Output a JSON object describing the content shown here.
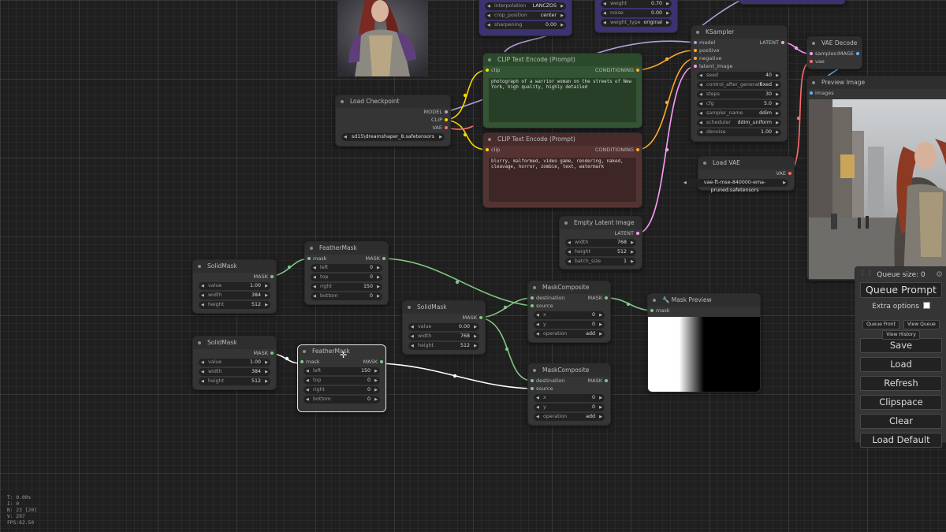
{
  "colors": {
    "model": "#b39ddb",
    "clip": "#ffd500",
    "vae": "#ff6e6e",
    "conditioning": "#ffa931",
    "latent": "#ff9cf9",
    "mask": "#81c784",
    "image": "#64b5f6",
    "selected_link": "#ffffff"
  },
  "nodes": {
    "top1": {
      "widgets": [
        {
          "label": "interpolation",
          "value": "LANCZOS"
        },
        {
          "label": "crop_position",
          "value": "center"
        },
        {
          "label": "sharpening",
          "value": "0.00"
        }
      ]
    },
    "top2": {
      "widgets": [
        {
          "label": "weight",
          "value": "0.70"
        },
        {
          "label": "noise",
          "value": "0.00"
        },
        {
          "label": "weight_type",
          "value": "original"
        }
      ]
    },
    "load_checkpoint": {
      "title": "Load Checkpoint",
      "outputs": [
        "MODEL",
        "CLIP",
        "VAE"
      ],
      "widget": {
        "label": "ckpt_name",
        "value": "sd15\\dreamshaper_8.safetensors"
      }
    },
    "clip_pos": {
      "title": "CLIP Text Encode (Prompt)",
      "input": "clip",
      "output": "CONDITIONING",
      "text": "photograph of a warrior woman on the streets of New York, high quality, highly detailed"
    },
    "clip_neg": {
      "title": "CLIP Text Encode (Prompt)",
      "input": "clip",
      "output": "CONDITIONING",
      "text": "blurry, malformed, video game, rendering, naked, cleavage, horror, zombie, text, watermark"
    },
    "ksampler": {
      "title": "KSampler",
      "inputs": [
        "model",
        "positive",
        "negative",
        "latent_image"
      ],
      "output": "LATENT",
      "widgets": [
        {
          "label": "seed",
          "value": "40"
        },
        {
          "label": "control_after_generate",
          "value": "fixed"
        },
        {
          "label": "steps",
          "value": "30"
        },
        {
          "label": "cfg",
          "value": "5.0"
        },
        {
          "label": "sampler_name",
          "value": "ddim"
        },
        {
          "label": "scheduler",
          "value": "ddim_uniform"
        },
        {
          "label": "denoise",
          "value": "1.00"
        }
      ]
    },
    "vae_decode": {
      "title": "VAE Decode",
      "inputs": [
        "samples",
        "vae"
      ],
      "output": "IMAGE"
    },
    "preview_image": {
      "title": "Preview Image",
      "input": "images"
    },
    "load_vae": {
      "title": "Load VAE",
      "output": "VAE",
      "widget": {
        "label": "vae_name",
        "value": "vae-ft-mse-840000-ema-pruned.safetensors"
      }
    },
    "empty_latent": {
      "title": "Empty Latent Image",
      "output": "LATENT",
      "widgets": [
        {
          "label": "width",
          "value": "768"
        },
        {
          "label": "height",
          "value": "512"
        },
        {
          "label": "batch_size",
          "value": "1"
        }
      ]
    },
    "solidmask1": {
      "title": "SolidMask",
      "output": "MASK",
      "widgets": [
        {
          "label": "value",
          "value": "1.00"
        },
        {
          "label": "width",
          "value": "384"
        },
        {
          "label": "height",
          "value": "512"
        }
      ]
    },
    "feathermask1": {
      "title": "FeatherMask",
      "input": "mask",
      "output": "MASK",
      "widgets": [
        {
          "label": "left",
          "value": "0"
        },
        {
          "label": "top",
          "value": "0"
        },
        {
          "label": "right",
          "value": "150"
        },
        {
          "label": "bottom",
          "value": "0"
        }
      ]
    },
    "solidmask2": {
      "title": "SolidMask",
      "output": "MASK",
      "widgets": [
        {
          "label": "value",
          "value": "1.00"
        },
        {
          "label": "width",
          "value": "384"
        },
        {
          "label": "height",
          "value": "512"
        }
      ]
    },
    "feathermask2": {
      "title": "FeatherMask",
      "input": "mask",
      "output": "MASK",
      "widgets": [
        {
          "label": "left",
          "value": "150"
        },
        {
          "label": "top",
          "value": "0"
        },
        {
          "label": "right",
          "value": "0"
        },
        {
          "label": "bottom",
          "value": "0"
        }
      ]
    },
    "solidmask3": {
      "title": "SolidMask",
      "output": "MASK",
      "widgets": [
        {
          "label": "value",
          "value": "0.00"
        },
        {
          "label": "width",
          "value": "768"
        },
        {
          "label": "height",
          "value": "512"
        }
      ]
    },
    "maskcomp1": {
      "title": "MaskComposite",
      "inputs": [
        "destination",
        "source"
      ],
      "output": "MASK",
      "widgets": [
        {
          "label": "x",
          "value": "0"
        },
        {
          "label": "y",
          "value": "0"
        },
        {
          "label": "operation",
          "value": "add"
        }
      ]
    },
    "maskcomp2": {
      "title": "MaskComposite",
      "inputs": [
        "destination",
        "source"
      ],
      "output": "MASK",
      "widgets": [
        {
          "label": "x",
          "value": "0"
        },
        {
          "label": "y",
          "value": "0"
        },
        {
          "label": "operation",
          "value": "add"
        }
      ]
    },
    "mask_preview": {
      "title": "🔧 Mask Preview",
      "input": "mask"
    }
  },
  "stats": {
    "t": "T: 0.00s",
    "i": "I: 0",
    "n": "N: 23 [20]",
    "v": "V: 297",
    "fps": "FPS:62.50"
  },
  "queue_panel": {
    "queue_size": "Queue size: 0",
    "queue_prompt": "Queue Prompt",
    "extra_options": "Extra options",
    "queue_front": "Queue Front",
    "view_queue": "View Queue",
    "view_history": "View History",
    "save": "Save",
    "load": "Load",
    "refresh": "Refresh",
    "clipspace": "Clipspace",
    "clear": "Clear",
    "load_default": "Load Default"
  }
}
